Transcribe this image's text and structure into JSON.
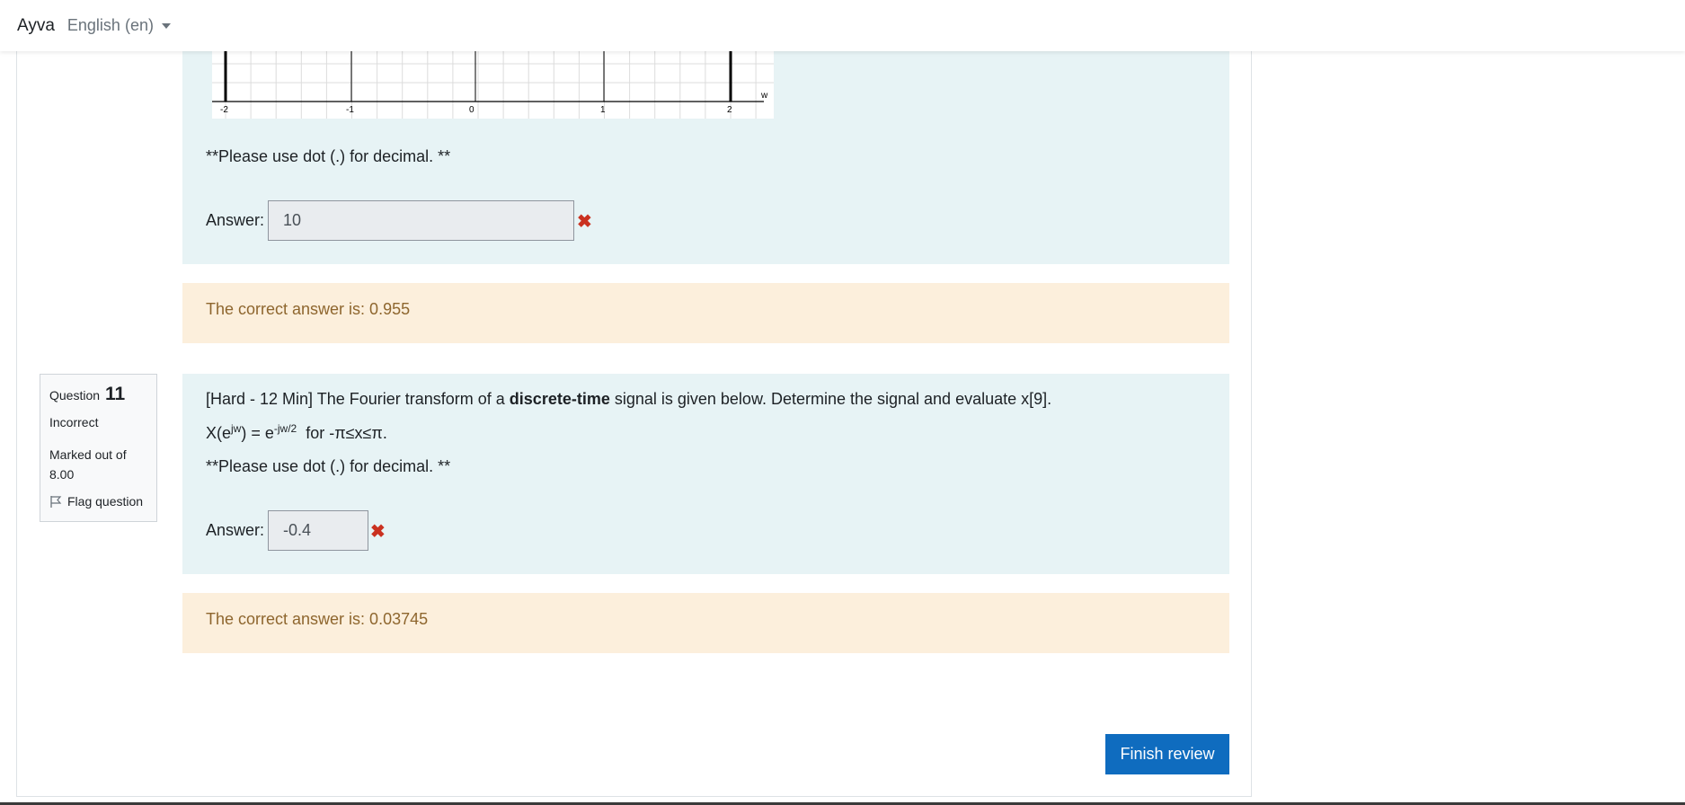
{
  "navbar": {
    "brand": "Ayva",
    "language": "English (en)"
  },
  "previous_question": {
    "graph": {
      "tick_labels": [
        "-2",
        "-1",
        "0",
        "1",
        "2"
      ],
      "axis_label": "w"
    },
    "decimal_note": "**Please use dot (.) for decimal. **",
    "answer_label": "Answer:",
    "answer_value": "10",
    "correct_answer": "The correct answer is: 0.955"
  },
  "question11": {
    "info": {
      "question_word": "Question",
      "number": "11",
      "state": "Incorrect",
      "mark": "Marked out of 8.00",
      "flag_label": "Flag question"
    },
    "text_before": "[Hard - 12 Min] The Fourier transform of a ",
    "text_bold": "discrete-time",
    "text_after": " signal is given below. Determine the signal and evaluate x[9].",
    "formula": {
      "lhs_base": "X(e",
      "lhs_sup": "jw",
      "lhs_close": ") = e",
      "rhs_sup": "-jw/2",
      "range": "for -π≤x≤π."
    },
    "decimal_note": "**Please use dot (.) for decimal. **",
    "answer_label": "Answer:",
    "answer_value": "-0.4",
    "correct_answer": "The correct answer is: 0.03745"
  },
  "finish_button": "Finish review",
  "colors": {
    "question_bg": "#e7f3f5",
    "feedback_bg": "#fcefdc",
    "feedback_text": "#8e662e",
    "incorrect_icon": "#ca3120",
    "primary_button": "#0f6cbf"
  },
  "icons": {
    "incorrect": "cross-icon",
    "flag": "flag-icon",
    "language": "caret-down-icon"
  }
}
